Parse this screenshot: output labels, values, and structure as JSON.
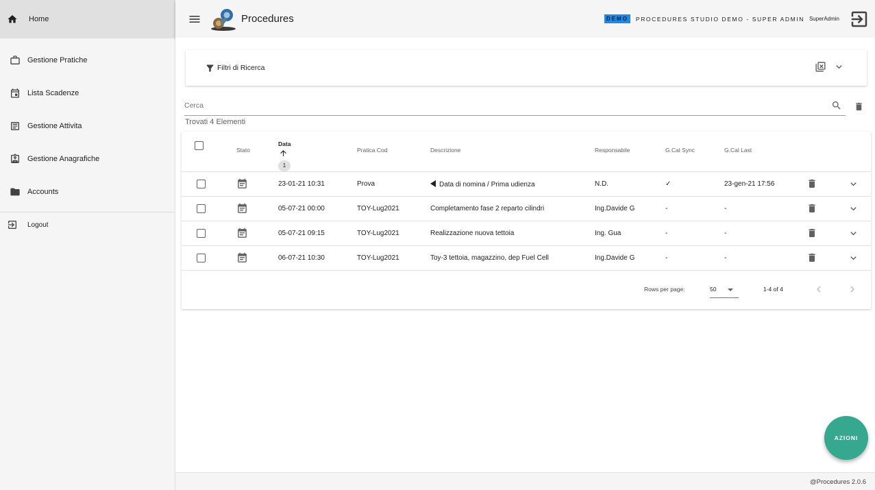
{
  "sidebar": {
    "home": {
      "label": "Home",
      "icon": "home-icon"
    },
    "items": [
      {
        "label": "Gestione Pratiche",
        "icon": "briefcase-icon"
      },
      {
        "label": "Lista Scadenze",
        "icon": "calendar-icon"
      },
      {
        "label": "Gestione Attivita",
        "icon": "document-list-icon"
      },
      {
        "label": "Gestione Anagrafiche",
        "icon": "contact-badge-icon"
      },
      {
        "label": "Accounts",
        "icon": "folder-icon"
      }
    ],
    "logout": {
      "label": "Logout",
      "icon": "logout-icon"
    }
  },
  "header": {
    "title": "Procedures",
    "demo_badge": "DEMO",
    "studio": "PROCEDURES STUDIO DEMO - SUPER ADMIN",
    "user": "SuperAdmin"
  },
  "filters": {
    "title": "Filtri di Ricerca"
  },
  "search": {
    "placeholder": "Cerca"
  },
  "results": {
    "found_text": "Trovati 4 Elementi"
  },
  "table": {
    "columns": {
      "stato": "Stato",
      "data": "Data",
      "pratica_cod": "Pratica Cod",
      "descrizione": "Descrizione",
      "responsabile": "Responsabile",
      "gcal_sync": "G.Cal Sync",
      "gcal_last": "G.Cal Last"
    },
    "sort_order": "1",
    "rows": [
      {
        "data": "23-01-21 10:31",
        "pratica": "Prova",
        "descrizione": "Data di nomina / Prima udienza",
        "responsabile": "N.D.",
        "sync": "✓",
        "last": "23-gen-21 17:56"
      },
      {
        "data": "05-07-21 00:00",
        "pratica": "TOY-Lug2021",
        "descrizione": "Completamento fase 2 reparto cilindri",
        "responsabile": "Ing.Davide G",
        "sync": "-",
        "last": "-"
      },
      {
        "data": "05-07-21 09:15",
        "pratica": "TOY-Lug2021",
        "descrizione": "Realizzazione nuova tettoia",
        "responsabile": "Ing. Gua",
        "sync": "-",
        "last": "-"
      },
      {
        "data": "06-07-21 10:30",
        "pratica": "TOY-Lug2021",
        "descrizione": "Toy-3 tettoia, magazzino, dep Fuel Cell",
        "responsabile": "Ing.Davide G",
        "sync": "-",
        "last": "-"
      }
    ]
  },
  "pagination": {
    "rows_per_page_label": "Rows per page:",
    "rows_per_page": "50",
    "range": "1-4 of 4"
  },
  "fab": {
    "label": "AZIONI"
  },
  "footer": {
    "version": "@Procedures 2.0.6"
  },
  "colors": {
    "accent": "#36a88f",
    "demo_badge": "#1e88e5"
  }
}
